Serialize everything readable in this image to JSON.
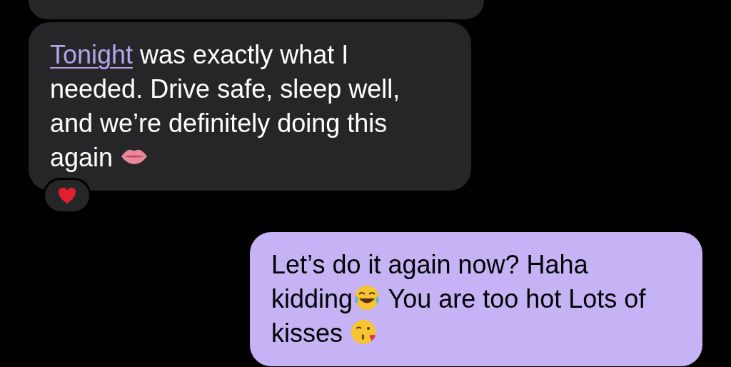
{
  "messages": [
    {
      "kind": "incoming",
      "cut_off": true
    },
    {
      "kind": "incoming",
      "segments": [
        {
          "kind": "link",
          "text": "Tonight"
        },
        {
          "kind": "text",
          "text": " was exactly what I needed. Drive safe, sleep well, and we’re definitely doing this again "
        },
        {
          "kind": "lips"
        }
      ],
      "reaction": {
        "kind": "heart"
      }
    },
    {
      "kind": "outgoing",
      "segments": [
        {
          "kind": "text",
          "text": "Let’s do it again now? Haha kidding"
        },
        {
          "kind": "laugh"
        },
        {
          "kind": "text",
          "text": " You are too hot Lots of kisses "
        },
        {
          "kind": "kiss"
        }
      ]
    }
  ]
}
